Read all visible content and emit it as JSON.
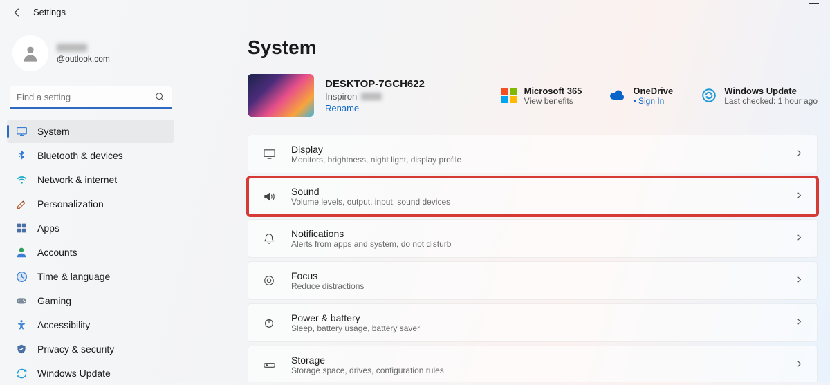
{
  "header": {
    "title": "Settings"
  },
  "profile": {
    "email": "@outlook.com"
  },
  "search": {
    "placeholder": "Find a setting"
  },
  "nav": [
    {
      "label": "System",
      "icon": "system"
    },
    {
      "label": "Bluetooth & devices",
      "icon": "bluetooth"
    },
    {
      "label": "Network & internet",
      "icon": "wifi"
    },
    {
      "label": "Personalization",
      "icon": "paint"
    },
    {
      "label": "Apps",
      "icon": "apps"
    },
    {
      "label": "Accounts",
      "icon": "account"
    },
    {
      "label": "Time & language",
      "icon": "time"
    },
    {
      "label": "Gaming",
      "icon": "gaming"
    },
    {
      "label": "Accessibility",
      "icon": "accessibility"
    },
    {
      "label": "Privacy & security",
      "icon": "privacy"
    },
    {
      "label": "Windows Update",
      "icon": "update"
    }
  ],
  "page": {
    "title": "System",
    "device": {
      "name": "DESKTOP-7GCH622",
      "model": "Inspiron",
      "rename": "Rename"
    },
    "status": {
      "ms365": {
        "title": "Microsoft 365",
        "sub": "View benefits"
      },
      "onedrive": {
        "title": "OneDrive",
        "sub": "Sign In",
        "dot": "•"
      },
      "update": {
        "title": "Windows Update",
        "sub": "Last checked: 1 hour ago"
      }
    },
    "cards": [
      {
        "title": "Display",
        "sub": "Monitors, brightness, night light, display profile",
        "icon": "display"
      },
      {
        "title": "Sound",
        "sub": "Volume levels, output, input, sound devices",
        "icon": "sound",
        "highlight": true
      },
      {
        "title": "Notifications",
        "sub": "Alerts from apps and system, do not disturb",
        "icon": "bell"
      },
      {
        "title": "Focus",
        "sub": "Reduce distractions",
        "icon": "focus"
      },
      {
        "title": "Power & battery",
        "sub": "Sleep, battery usage, battery saver",
        "icon": "power"
      },
      {
        "title": "Storage",
        "sub": "Storage space, drives, configuration rules",
        "icon": "storage"
      }
    ]
  }
}
